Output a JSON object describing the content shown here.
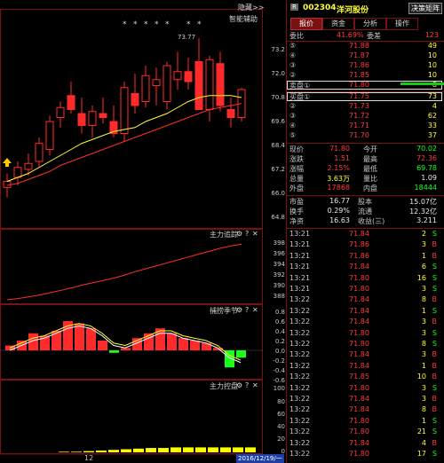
{
  "header": {
    "top_right_label": "隐藏>>"
  },
  "chart": {
    "assist_label": "智能辅助",
    "price_label": "73.77",
    "y_labels": [
      "73.2",
      "72.0",
      "70.8",
      "69.6",
      "68.4",
      "67.2",
      "66.0",
      "64.8"
    ],
    "vol_panel": {
      "title": "主力追踪",
      "y_labels": [
        "398",
        "396",
        "394",
        "392",
        "390",
        "388"
      ]
    },
    "season_panel": {
      "title": "捕捞季节",
      "y_labels": [
        "0.8",
        "0.6",
        "0.4",
        "0.2",
        "0.0",
        "-0.2",
        "-0.4",
        "-0.6"
      ]
    },
    "ctrl_panel": {
      "title": "主力控盘",
      "y_labels": [
        "100",
        "80",
        "60",
        "40",
        "20",
        "0"
      ]
    },
    "x_label": "12",
    "date_label": "2016/12/19/一",
    "panel_icons": [
      "⚙",
      "?",
      "✕"
    ]
  },
  "chart_data": {
    "type": "bar",
    "kline": [
      {
        "o": 66.3,
        "h": 67.0,
        "l": 65.8,
        "c": 66.6
      },
      {
        "o": 66.8,
        "h": 67.6,
        "l": 66.4,
        "c": 67.3
      },
      {
        "o": 67.2,
        "h": 68.0,
        "l": 66.9,
        "c": 67.5
      },
      {
        "o": 67.6,
        "h": 68.8,
        "l": 67.3,
        "c": 68.5
      },
      {
        "o": 68.2,
        "h": 69.9,
        "l": 67.9,
        "c": 69.6
      },
      {
        "o": 69.8,
        "h": 70.6,
        "l": 69.3,
        "c": 70.3
      },
      {
        "o": 70.9,
        "h": 71.6,
        "l": 70.0,
        "c": 70.2
      },
      {
        "o": 70.0,
        "h": 70.8,
        "l": 69.0,
        "c": 69.4
      },
      {
        "o": 69.4,
        "h": 70.4,
        "l": 68.8,
        "c": 70.1
      },
      {
        "o": 70.0,
        "h": 70.8,
        "l": 69.5,
        "c": 69.8
      },
      {
        "o": 69.6,
        "h": 70.4,
        "l": 68.8,
        "c": 69.0
      },
      {
        "o": 69.0,
        "h": 71.6,
        "l": 68.6,
        "c": 71.3
      },
      {
        "o": 71.0,
        "h": 72.0,
        "l": 70.0,
        "c": 70.4
      },
      {
        "o": 70.6,
        "h": 72.4,
        "l": 70.3,
        "c": 71.9
      },
      {
        "o": 71.4,
        "h": 72.3,
        "l": 70.4,
        "c": 71.7
      },
      {
        "o": 70.6,
        "h": 72.6,
        "l": 70.2,
        "c": 72.4
      },
      {
        "o": 71.7,
        "h": 73.1,
        "l": 71.2,
        "c": 72.1
      },
      {
        "o": 72.1,
        "h": 72.8,
        "l": 71.2,
        "c": 71.6
      },
      {
        "o": 72.6,
        "h": 73.77,
        "l": 71.4,
        "c": 70.2
      },
      {
        "o": 70.2,
        "h": 72.9,
        "l": 69.6,
        "c": 72.7
      },
      {
        "o": 72.5,
        "h": 73.1,
        "l": 70.1,
        "c": 70.4
      },
      {
        "o": 70.2,
        "h": 70.8,
        "l": 69.3,
        "c": 69.8
      },
      {
        "o": 69.8,
        "h": 71.3,
        "l": 69.6,
        "c": 71.2
      }
    ],
    "ma_yellow": [
      66.6,
      66.8,
      67.0,
      67.3,
      67.6,
      67.9,
      68.2,
      68.5,
      68.7,
      68.9,
      69.1,
      69.2,
      69.3,
      69.6,
      69.8,
      70.0,
      70.3,
      70.6,
      70.8,
      70.9,
      70.9,
      70.9,
      70.8
    ],
    "ma_red": [
      66.4,
      66.5,
      66.7,
      66.9,
      67.1,
      67.4,
      67.6,
      67.8,
      68.0,
      68.2,
      68.4,
      68.6,
      68.8,
      69.0,
      69.2,
      69.4,
      69.6,
      69.8,
      70.0,
      70.2,
      70.3,
      70.4,
      70.5
    ],
    "star_positions": [
      11,
      12,
      13,
      14,
      15,
      17,
      18
    ],
    "vol_line": [
      388.0,
      388.2,
      388.5,
      388.8,
      389.2,
      389.6,
      390.0,
      390.5,
      390.9,
      391.3,
      391.7,
      392.2,
      392.8,
      393.3,
      393.8,
      394.3,
      394.8,
      395.3,
      395.8,
      396.3,
      396.8,
      397.2,
      397.5
    ],
    "season_bars": [
      0.1,
      0.2,
      0.35,
      0.3,
      0.4,
      0.6,
      0.55,
      0.45,
      0.2,
      -0.05,
      0.05,
      0.25,
      0.35,
      0.45,
      0.35,
      0.25,
      0.2,
      0.15,
      0.05,
      -0.35,
      -0.15
    ],
    "season_line": [
      0.05,
      0.15,
      0.25,
      0.3,
      0.4,
      0.5,
      0.55,
      0.5,
      0.35,
      0.15,
      0.1,
      0.2,
      0.3,
      0.4,
      0.4,
      0.3,
      0.25,
      0.2,
      0.1,
      -0.1,
      -0.2
    ],
    "ctrl_bars": [
      0,
      0,
      0,
      0,
      0,
      0,
      0,
      0,
      0,
      0,
      0,
      0,
      1,
      1,
      2,
      3,
      4,
      5,
      6,
      7,
      7,
      8,
      8,
      8,
      8,
      8,
      8,
      8
    ]
  },
  "stock": {
    "code": "002304",
    "name": "洋河股份",
    "decision_btn": "决策矩阵",
    "tag": "R"
  },
  "tabs": [
    "报价",
    "资金",
    "分析",
    "操作"
  ],
  "orderbook": {
    "wei_bi_label": "委比",
    "wei_bi": "41.69%",
    "wei_cha_label": "委差",
    "wei_cha": "123",
    "sell": [
      {
        "label": "⑤",
        "price": "71.88",
        "vol": "49"
      },
      {
        "label": "④",
        "price": "71.87",
        "vol": "10"
      },
      {
        "label": "③",
        "price": "71.86",
        "vol": "10"
      },
      {
        "label": "②",
        "price": "71.85",
        "vol": "10"
      },
      {
        "label": "卖盘①",
        "price": "71.80",
        "vol": "8"
      }
    ],
    "buy": [
      {
        "label": "买盘①",
        "price": "71.75",
        "vol": "73"
      },
      {
        "label": "②",
        "price": "71.73",
        "vol": "4"
      },
      {
        "label": "③",
        "price": "71.72",
        "vol": "62"
      },
      {
        "label": "④",
        "price": "71.71",
        "vol": "33"
      },
      {
        "label": "⑤",
        "price": "71.70",
        "vol": "37"
      }
    ]
  },
  "quote": {
    "rows": [
      {
        "l1": "现价",
        "v1": "71.80",
        "l2": "今开",
        "v2": "70.02"
      },
      {
        "l1": "涨跌",
        "v1": "1.51",
        "l2": "最高",
        "v2": "72.36"
      },
      {
        "l1": "涨幅",
        "v1": "2.15%",
        "l2": "最低",
        "v2": "69.78"
      },
      {
        "l1": "总量",
        "v1": "3.63万",
        "l2": "量比",
        "v2": "1.09"
      },
      {
        "l1": "外盘",
        "v1": "17868",
        "l2": "内盘",
        "v2": "18444"
      }
    ],
    "rows2": [
      {
        "l1": "市盈",
        "v1": "16.77",
        "l2": "股本",
        "v2": "15.07亿"
      },
      {
        "l1": "换手",
        "v1": "0.29%",
        "l2": "流通",
        "v2": "12.32亿"
      },
      {
        "l1": "净资",
        "v1": "16.63",
        "l2": "收益(三)",
        "v2": "3.211"
      }
    ]
  },
  "ticks": [
    {
      "t": "13:21",
      "p": "71.84",
      "v": "2",
      "d": "S"
    },
    {
      "t": "13:21",
      "p": "71.86",
      "v": "3",
      "d": "B"
    },
    {
      "t": "13:21",
      "p": "71.86",
      "v": "1",
      "d": "B"
    },
    {
      "t": "13:21",
      "p": "71.84",
      "v": "6",
      "d": "S"
    },
    {
      "t": "13:21",
      "p": "71.80",
      "v": "16",
      "d": "S"
    },
    {
      "t": "13:21",
      "p": "71.80",
      "v": "3",
      "d": "S"
    },
    {
      "t": "13:22",
      "p": "71.84",
      "v": "8",
      "d": "B"
    },
    {
      "t": "13:22",
      "p": "71.84",
      "v": "1",
      "d": "S"
    },
    {
      "t": "13:22",
      "p": "71.84",
      "v": "3",
      "d": "B"
    },
    {
      "t": "13:22",
      "p": "71.80",
      "v": "3",
      "d": "S"
    },
    {
      "t": "13:22",
      "p": "71.80",
      "v": "8",
      "d": "S"
    },
    {
      "t": "13:22",
      "p": "71.84",
      "v": "3",
      "d": "B"
    },
    {
      "t": "13:22",
      "p": "71.84",
      "v": "1",
      "d": "B"
    },
    {
      "t": "13:22",
      "p": "71.85",
      "v": "10",
      "d": "B"
    },
    {
      "t": "13:22",
      "p": "71.80",
      "v": "3",
      "d": "S"
    },
    {
      "t": "13:22",
      "p": "71.84",
      "v": "3",
      "d": "B"
    },
    {
      "t": "13:22",
      "p": "71.84",
      "v": "8",
      "d": "B"
    },
    {
      "t": "13:22",
      "p": "71.80",
      "v": "1",
      "d": "S"
    },
    {
      "t": "13:22",
      "p": "71.80",
      "v": "21",
      "d": "S"
    },
    {
      "t": "13:22",
      "p": "71.84",
      "v": "4",
      "d": "B"
    },
    {
      "t": "13:22",
      "p": "71.80",
      "v": "17",
      "d": "S"
    }
  ],
  "colors": {
    "up": "#ff2a2a",
    "down": "#19ff19",
    "ma1": "#ffff33",
    "ma2": "#ff3030",
    "border": "#7a1010"
  }
}
